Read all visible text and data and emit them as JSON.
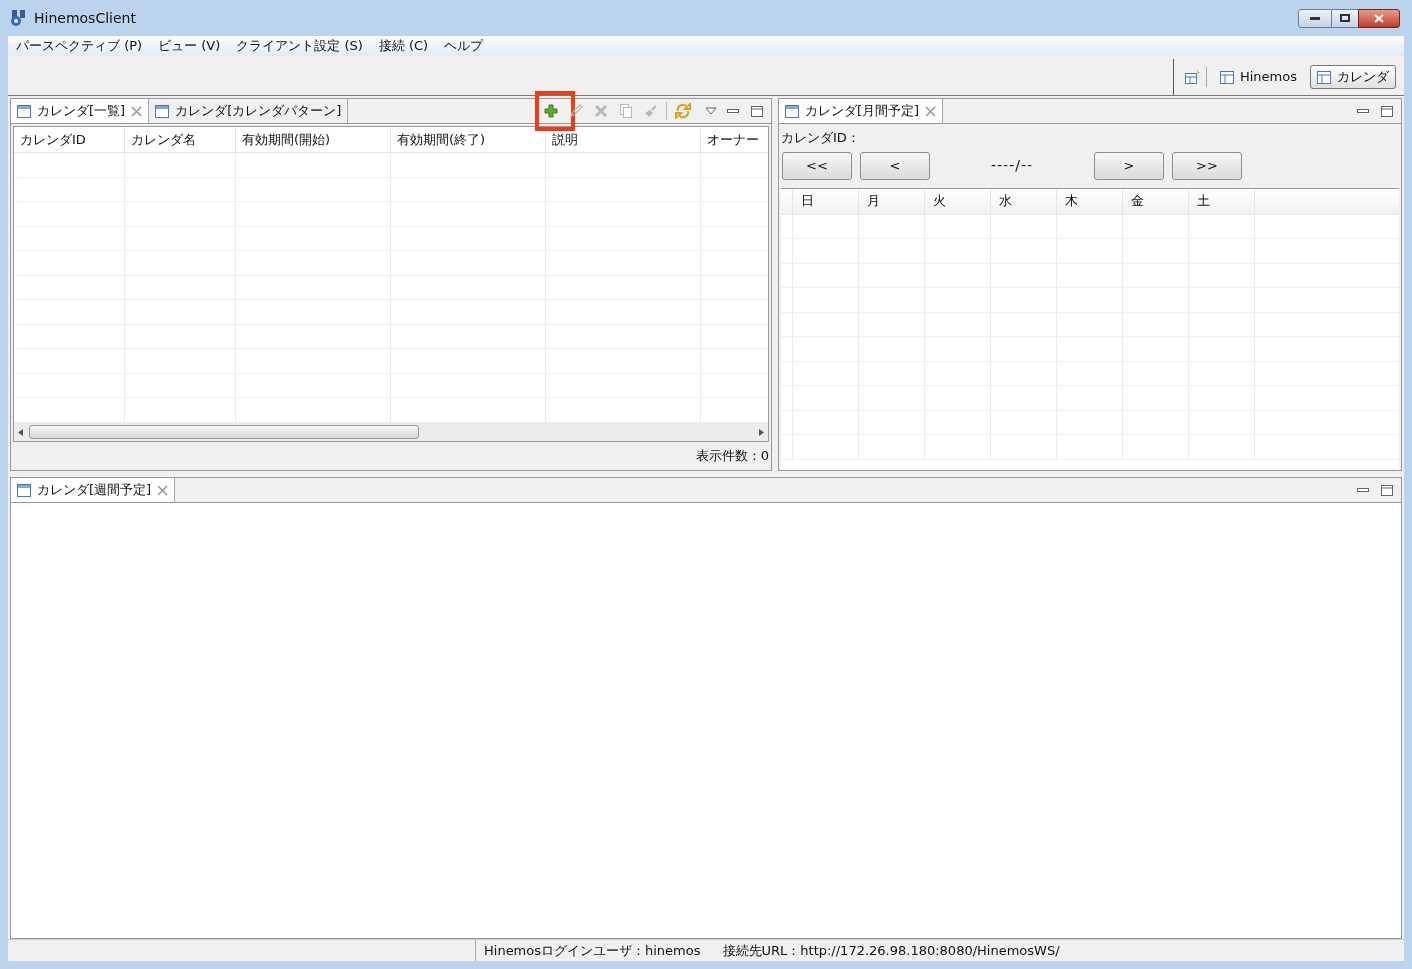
{
  "window": {
    "title": "HinemosClient"
  },
  "menu": [
    "パースペクティブ (P)",
    "ビュー (V)",
    "クライアント設定 (S)",
    "接続 (C)",
    "ヘルプ"
  ],
  "perspectives": [
    {
      "label": "Hinemos",
      "selected": false
    },
    {
      "label": "カレンダ",
      "selected": true
    }
  ],
  "list_panel": {
    "tabs": [
      {
        "label": "カレンダ[一覧]",
        "selected": true,
        "closable": true
      },
      {
        "label": "カレンダ[カレンダパターン]",
        "selected": false,
        "closable": false
      }
    ],
    "toolbar": [
      {
        "kind": "add",
        "disabled": false,
        "highlighted": true
      },
      {
        "kind": "edit",
        "disabled": true,
        "highlighted": false
      },
      {
        "kind": "delete",
        "disabled": true,
        "highlighted": false
      },
      {
        "kind": "copy",
        "disabled": true,
        "highlighted": false
      },
      {
        "kind": "privilege",
        "disabled": true,
        "highlighted": false
      },
      {
        "kind": "refresh",
        "disabled": false,
        "highlighted": false
      }
    ],
    "columns": [
      "カレンダID",
      "カレンダ名",
      "有効期間(開始)",
      "有効期間(終了)",
      "説明",
      "オーナー"
    ],
    "count": "表示件数：0"
  },
  "month_panel": {
    "tab": {
      "label": "カレンダ[月間予定]",
      "selected": true,
      "closable": true
    },
    "calendar_id_label": "カレンダID：",
    "month": "----/--",
    "buttons_before": [
      "<<",
      "<"
    ],
    "buttons_after": [
      ">",
      ">>"
    ],
    "weekdays": [
      "日",
      "月",
      "火",
      "水",
      "木",
      "金",
      "土"
    ]
  },
  "week_panel": {
    "tab": {
      "label": "カレンダ[週間予定]",
      "selected": true,
      "closable": true
    }
  },
  "status_bar": {
    "user": "Hinemosログインユーザ：hinemos",
    "url": "接続先URL：http://172.26.98.180:8080/HinemosWS/"
  }
}
